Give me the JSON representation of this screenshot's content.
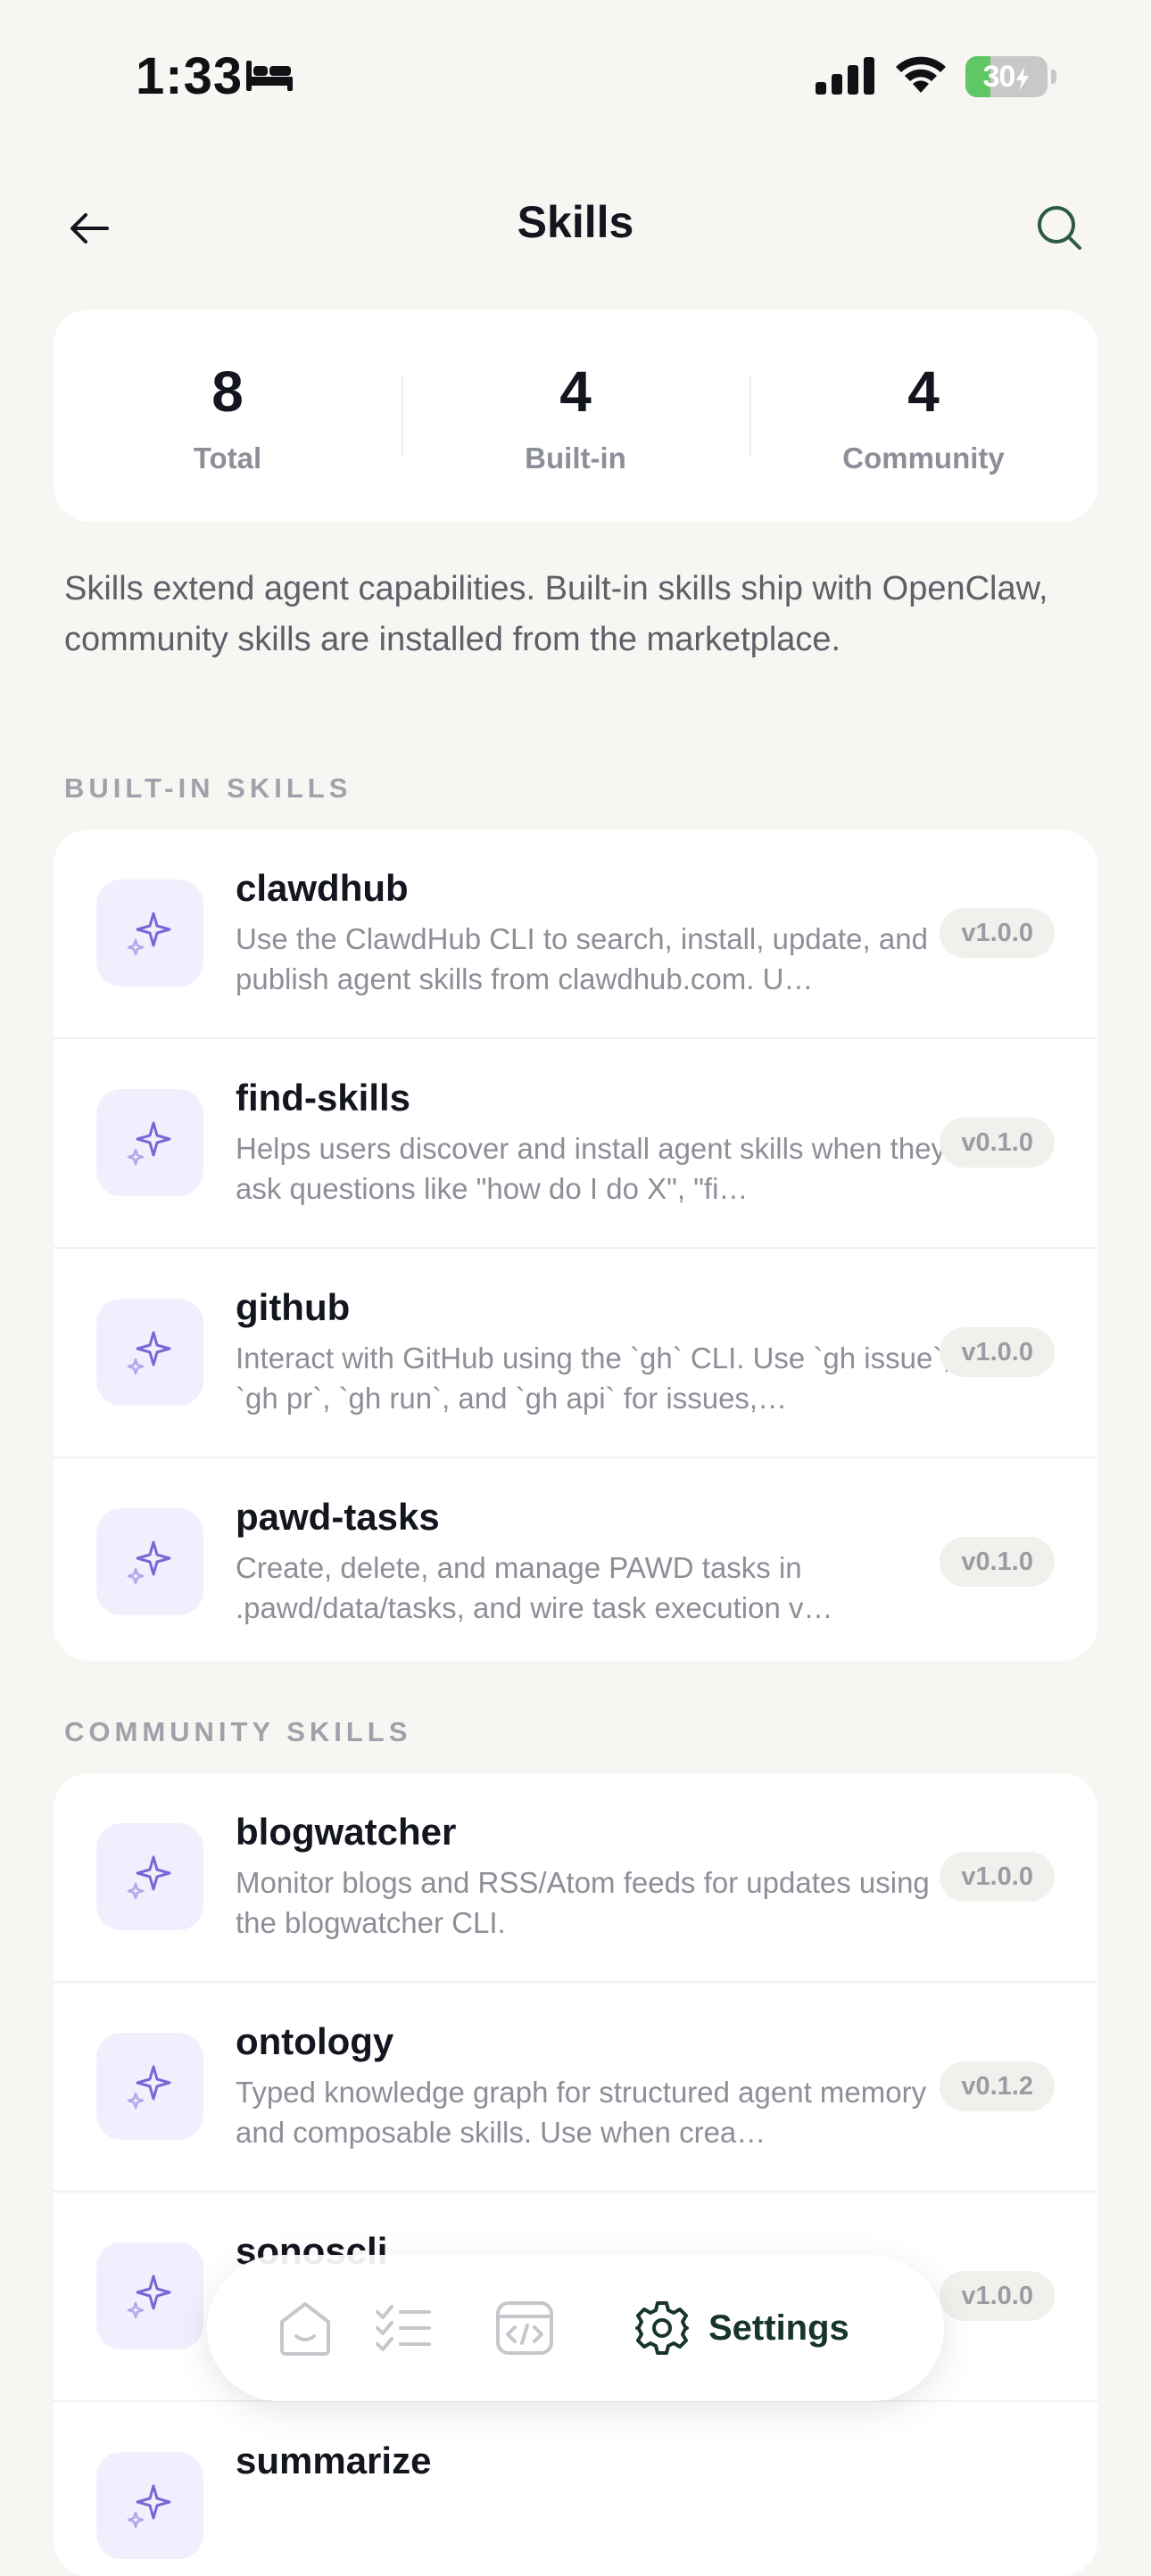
{
  "status_bar": {
    "time": "1:33",
    "battery": "30"
  },
  "header": {
    "title": "Skills"
  },
  "stats": [
    {
      "value": "8",
      "label": "Total"
    },
    {
      "value": "4",
      "label": "Built-in"
    },
    {
      "value": "4",
      "label": "Community"
    }
  ],
  "description": "Skills extend agent capabilities. Built-in skills ship with OpenClaw, community skills are installed from the marketplace.",
  "builtin_section": {
    "title": "BUILT-IN SKILLS",
    "items": [
      {
        "name": "clawdhub",
        "description": "Use the ClawdHub CLI to search, install, update, and publish agent skills from clawdhub.com. U…",
        "version": "v1.0.0"
      },
      {
        "name": "find-skills",
        "description": "Helps users discover and install agent skills when they ask questions like \"how do I do X\", \"fi…",
        "version": "v0.1.0"
      },
      {
        "name": "github",
        "description": "Interact with GitHub using the `gh` CLI. Use `gh issue`, `gh pr`, `gh run`, and `gh api` for issues,…",
        "version": "v1.0.0"
      },
      {
        "name": "pawd-tasks",
        "description": "Create, delete, and manage PAWD tasks in .pawd/data/tasks, and wire task execution v…",
        "version": "v0.1.0"
      }
    ]
  },
  "community_section": {
    "title": "COMMUNITY SKILLS",
    "items": [
      {
        "name": "blogwatcher",
        "description": "Monitor blogs and RSS/Atom feeds for updates using the blogwatcher CLI.",
        "version": "v1.0.0"
      },
      {
        "name": "ontology",
        "description": "Typed knowledge graph for structured agent memory and composable skills. Use when crea…",
        "version": "v0.1.2"
      },
      {
        "name": "sonoscli",
        "description": "",
        "version": "v1.0.0"
      },
      {
        "name": "summarize",
        "description": "",
        "version": ""
      }
    ]
  },
  "tab_bar": {
    "settings_label": "Settings",
    "active_color": "#17352c"
  },
  "colors": {
    "accent_purple": "#7b66d6",
    "icon_bg": "#f2eefd",
    "background": "#f7f6f3"
  }
}
